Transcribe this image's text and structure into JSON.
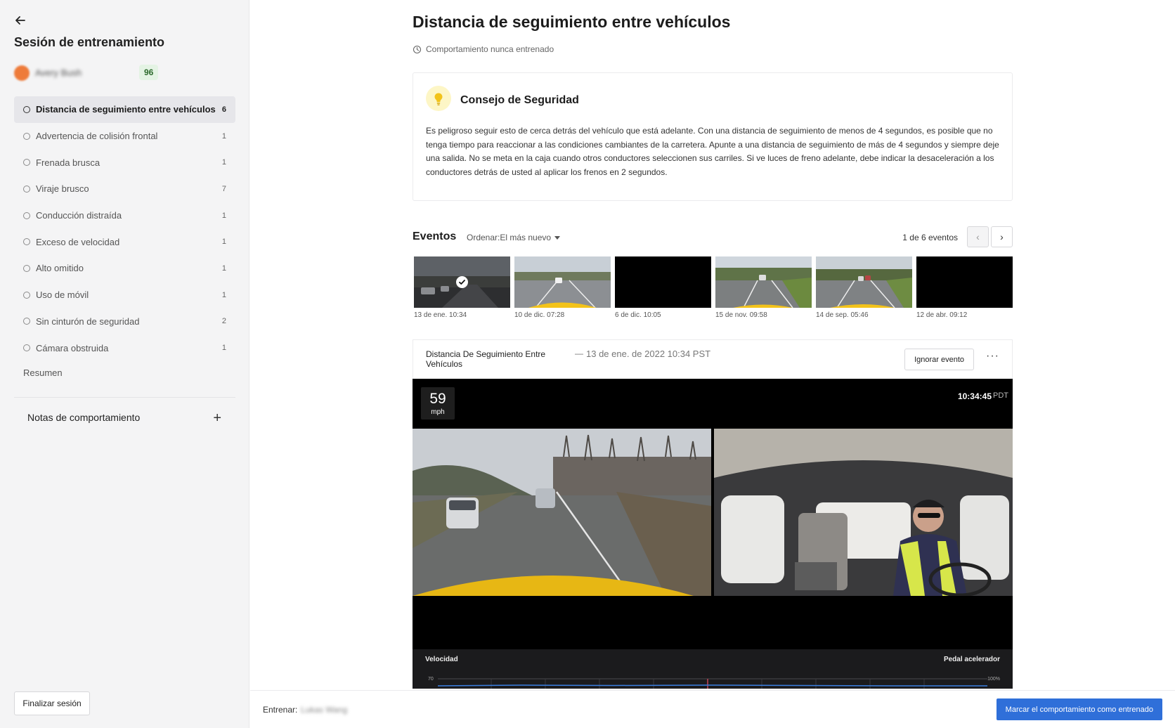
{
  "sidebar": {
    "title": "Sesión de entrenamiento",
    "driver": {
      "name": "Avery Bush",
      "score": "96"
    },
    "behaviors": [
      {
        "label": "Distancia de seguimiento entre vehículos",
        "count": "6"
      },
      {
        "label": "Advertencia de colisión frontal",
        "count": "1"
      },
      {
        "label": "Frenada brusca",
        "count": "1"
      },
      {
        "label": "Viraje brusco",
        "count": "7"
      },
      {
        "label": "Conducción distraída",
        "count": "1"
      },
      {
        "label": "Exceso de velocidad",
        "count": "1"
      },
      {
        "label": "Alto omitido",
        "count": "1"
      },
      {
        "label": "Uso de móvil",
        "count": "1"
      },
      {
        "label": "Sin cinturón de seguridad",
        "count": "2"
      },
      {
        "label": "Cámara obstruida",
        "count": "1"
      }
    ],
    "summary_label": "Resumen",
    "notes_label": "Notas de comportamiento",
    "notes_add": "+",
    "finish_label": "Finalizar sesión"
  },
  "main": {
    "title": "Distancia de seguimiento entre vehículos",
    "history_text": "Comportamiento nunca entrenado",
    "tip": {
      "title": "Consejo de Seguridad",
      "body": "Es peligroso seguir esto de cerca detrás del vehículo que está adelante. Con una distancia de seguimiento de menos de 4 segundos, es posible que no tenga tiempo para reaccionar a las condiciones cambiantes de la carretera. Apunte a una distancia de seguimiento de más de 4 segundos y siempre deje una salida. No se meta en la caja cuando otros conductores seleccionen sus carriles. Si ve luces de freno adelante, debe indicar la desaceleración a los conductores detrás de usted al aplicar los frenos en 2 segundos."
    },
    "events": {
      "label": "Eventos",
      "sort_label": "Ordenar:El más nuevo",
      "count_text": "1 de 6 eventos",
      "prev": "‹",
      "next": "›",
      "thumbnails": [
        {
          "date": "13 de ene. 10:34",
          "selected": true
        },
        {
          "date": "10 de dic. 07:28",
          "selected": false
        },
        {
          "date": "6 de dic. 10:05",
          "selected": false
        },
        {
          "date": "15 de nov. 09:58",
          "selected": false
        },
        {
          "date": "14 de sep. 05:46",
          "selected": false
        },
        {
          "date": "12 de abr. 09:12",
          "selected": false
        }
      ]
    },
    "event_detail": {
      "name": "Distancia De Seguimiento Entre Vehículos",
      "dash": "—",
      "datetime": "13 de ene. de 2022 10:34 PST",
      "ignore_label": "Ignorar evento",
      "more": "···"
    },
    "video": {
      "speed": "59",
      "speed_unit": "mph",
      "time": "10:34:45",
      "tz": "PDT"
    },
    "telemetry": {
      "speed_label": "Velocidad",
      "pedal_label": "Pedal acelerador",
      "y_left": "70",
      "y_right": "100%"
    }
  },
  "footer": {
    "coach_label": "Entrenar:",
    "coach_name": "Lukas Wang",
    "mark_label": "Marcar el comportamiento como entrenado"
  },
  "colors": {
    "accent": "#2f6fd9",
    "score_bg": "#e4f3e4",
    "score_text": "#2d6a2d",
    "avatar": "#ee7b3a",
    "bulb_bg": "#fdf6c6"
  }
}
